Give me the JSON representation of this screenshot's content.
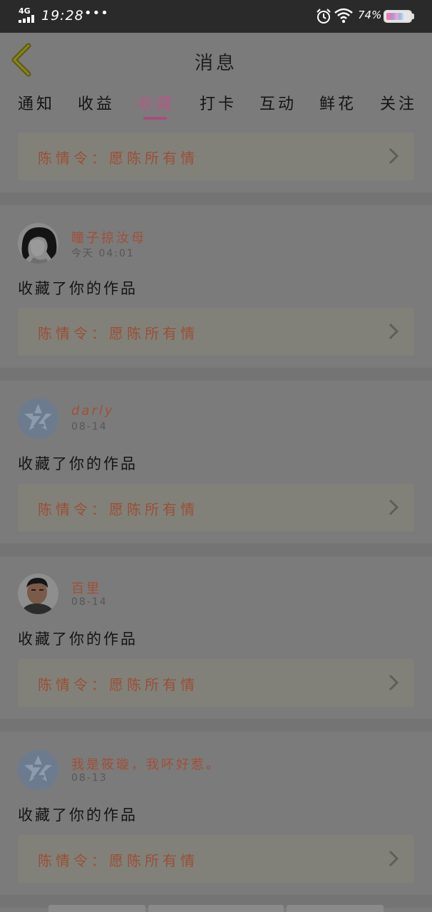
{
  "status_bar": {
    "network": "4G",
    "time": "19:28",
    "dots": "•••",
    "battery_percent": "74%",
    "battery_level": 0.74,
    "icons": [
      "signal-icon",
      "alarm-icon",
      "wifi-icon",
      "battery-icon"
    ]
  },
  "header": {
    "title": "消息",
    "back_icon": "chevron-left-icon"
  },
  "tabs": [
    {
      "label": "通知"
    },
    {
      "label": "收益"
    },
    {
      "label": "收藏"
    },
    {
      "label": "打卡"
    },
    {
      "label": "互动"
    },
    {
      "label": "鲜花"
    },
    {
      "label": "关注"
    }
  ],
  "active_tab": "收藏",
  "feed": {
    "top_work_title": "陈情令：愿陈所有情",
    "items": [
      {
        "user": "瞳子掠汝母",
        "time": "今天 04:01",
        "action": "收藏了你的作品",
        "work_title": "陈情令：愿陈所有情",
        "avatar": "sketch-avatar"
      },
      {
        "user": "darly",
        "time": "08-14",
        "action": "收藏了你的作品",
        "work_title": "陈情令：愿陈所有情",
        "avatar": "default-avatar"
      },
      {
        "user": "百里",
        "time": "08-14",
        "action": "收藏了你的作品",
        "work_title": "陈情令：愿陈所有情",
        "avatar": "photo-avatar"
      },
      {
        "user": "我是筱璇，我吥好惹。",
        "time": "08-13",
        "action": "收藏了你的作品",
        "work_title": "陈情令：愿陈所有情",
        "avatar": "default-avatar"
      }
    ]
  },
  "colors": {
    "overlay_bg": "#7b7b7b",
    "status_bar": "#2a2a2a",
    "accent": "#b04a7c",
    "username": "#a24f36",
    "work_card": "#81817a"
  }
}
